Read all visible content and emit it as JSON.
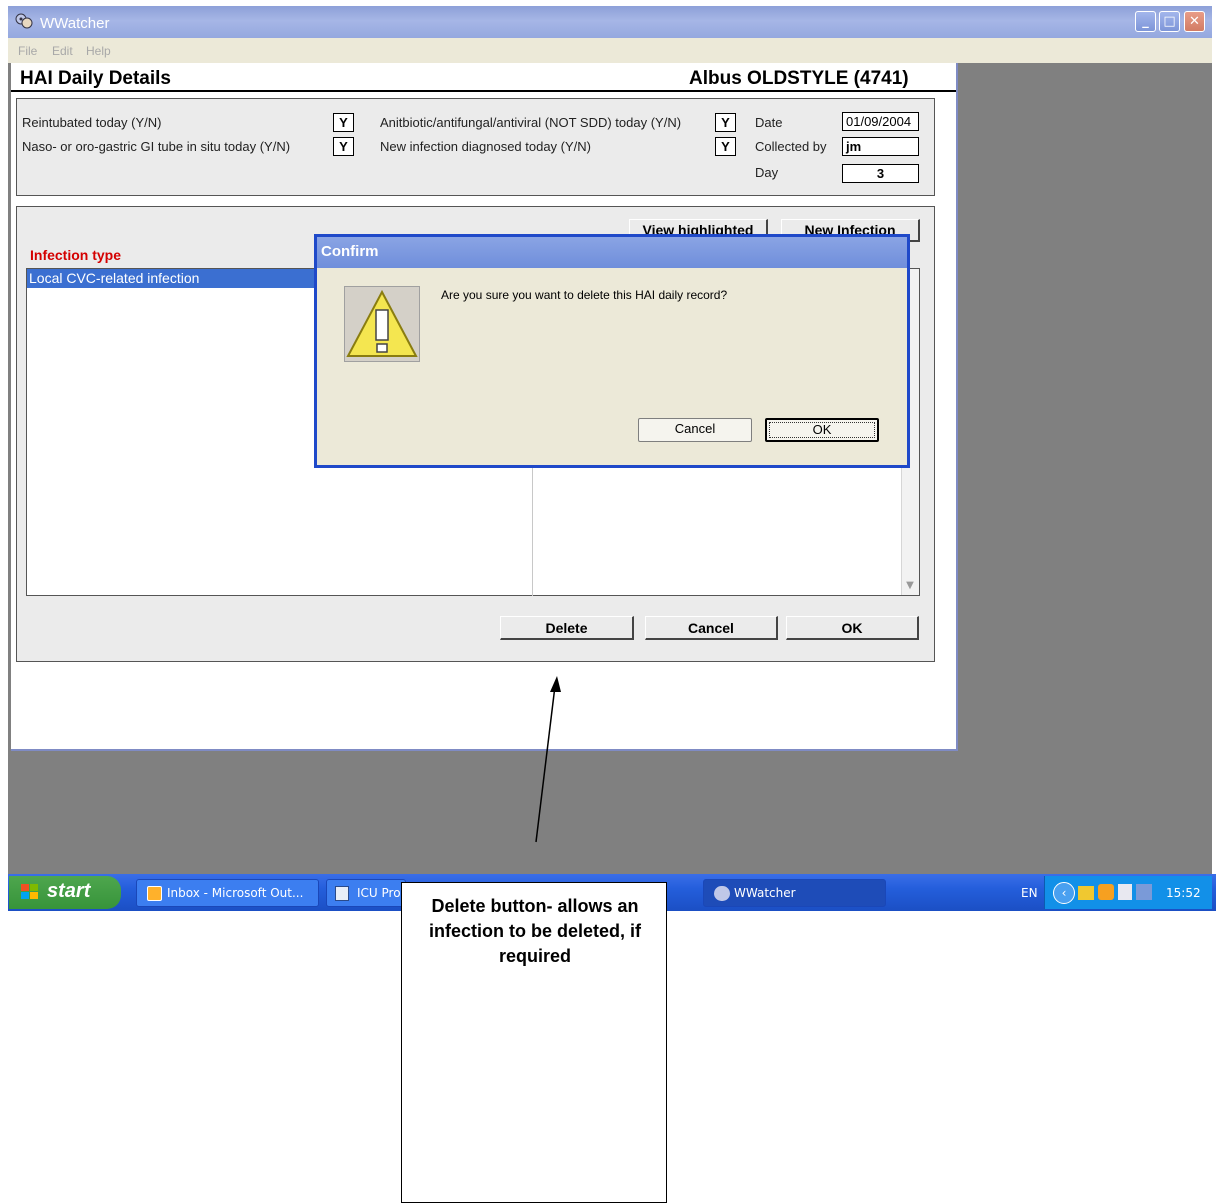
{
  "window": {
    "title": "WWatcher",
    "menu": [
      "File",
      "Edit",
      "Help"
    ]
  },
  "form": {
    "heading": "HAI Daily Details",
    "patient": "Albus OLDSTYLE (4741)",
    "fields": {
      "reintubated_label": "Reintubated today (Y/N)",
      "reintubated_value": "Y",
      "naso_label": "Naso- or oro-gastric GI tube in situ today (Y/N)",
      "naso_value": "Y",
      "antibiotic_label": "Anitbiotic/antifungal/antiviral (NOT SDD) today (Y/N)",
      "antibiotic_value": "Y",
      "newinf_label": "New infection diagnosed today (Y/N)",
      "newinf_value": "Y",
      "date_label": "Date",
      "date_value": "01/09/2004",
      "collected_label": "Collected by",
      "collected_value": "jm",
      "day_label": "Day",
      "day_value": "3"
    },
    "infection": {
      "type_label": "Infection type",
      "view_highlighted": "View highlighted",
      "new_infection": "New Infection",
      "rows": [
        "Local CVC-related infection"
      ]
    },
    "buttons": {
      "delete": "Delete",
      "cancel": "Cancel",
      "ok": "OK"
    }
  },
  "dialog": {
    "title": "Confirm",
    "message": "Are you sure you want to delete this HAI daily record?",
    "cancel": "Cancel",
    "ok": "OK",
    "icon": "warning-icon"
  },
  "taskbar": {
    "start": "start",
    "tasks": [
      "Inbox - Microsoft Out...",
      "ICU Pro",
      "WWatcher"
    ],
    "language": "EN",
    "clock": "15:52"
  },
  "annotation": {
    "text": "Delete button- allows an infection to be deleted, if required"
  }
}
